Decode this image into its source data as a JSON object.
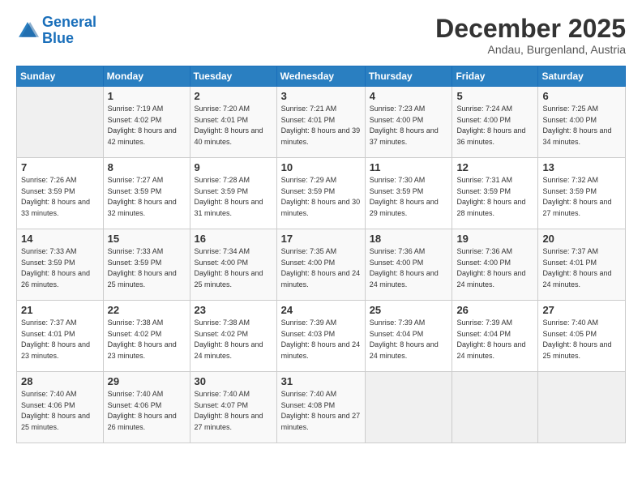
{
  "logo": {
    "line1": "General",
    "line2": "Blue"
  },
  "header": {
    "month": "December 2025",
    "location": "Andau, Burgenland, Austria"
  },
  "days_of_week": [
    "Sunday",
    "Monday",
    "Tuesday",
    "Wednesday",
    "Thursday",
    "Friday",
    "Saturday"
  ],
  "weeks": [
    [
      {
        "day": "",
        "sunrise": "",
        "sunset": "",
        "daylight": ""
      },
      {
        "day": "1",
        "sunrise": "Sunrise: 7:19 AM",
        "sunset": "Sunset: 4:02 PM",
        "daylight": "Daylight: 8 hours and 42 minutes."
      },
      {
        "day": "2",
        "sunrise": "Sunrise: 7:20 AM",
        "sunset": "Sunset: 4:01 PM",
        "daylight": "Daylight: 8 hours and 40 minutes."
      },
      {
        "day": "3",
        "sunrise": "Sunrise: 7:21 AM",
        "sunset": "Sunset: 4:01 PM",
        "daylight": "Daylight: 8 hours and 39 minutes."
      },
      {
        "day": "4",
        "sunrise": "Sunrise: 7:23 AM",
        "sunset": "Sunset: 4:00 PM",
        "daylight": "Daylight: 8 hours and 37 minutes."
      },
      {
        "day": "5",
        "sunrise": "Sunrise: 7:24 AM",
        "sunset": "Sunset: 4:00 PM",
        "daylight": "Daylight: 8 hours and 36 minutes."
      },
      {
        "day": "6",
        "sunrise": "Sunrise: 7:25 AM",
        "sunset": "Sunset: 4:00 PM",
        "daylight": "Daylight: 8 hours and 34 minutes."
      }
    ],
    [
      {
        "day": "7",
        "sunrise": "Sunrise: 7:26 AM",
        "sunset": "Sunset: 3:59 PM",
        "daylight": "Daylight: 8 hours and 33 minutes."
      },
      {
        "day": "8",
        "sunrise": "Sunrise: 7:27 AM",
        "sunset": "Sunset: 3:59 PM",
        "daylight": "Daylight: 8 hours and 32 minutes."
      },
      {
        "day": "9",
        "sunrise": "Sunrise: 7:28 AM",
        "sunset": "Sunset: 3:59 PM",
        "daylight": "Daylight: 8 hours and 31 minutes."
      },
      {
        "day": "10",
        "sunrise": "Sunrise: 7:29 AM",
        "sunset": "Sunset: 3:59 PM",
        "daylight": "Daylight: 8 hours and 30 minutes."
      },
      {
        "day": "11",
        "sunrise": "Sunrise: 7:30 AM",
        "sunset": "Sunset: 3:59 PM",
        "daylight": "Daylight: 8 hours and 29 minutes."
      },
      {
        "day": "12",
        "sunrise": "Sunrise: 7:31 AM",
        "sunset": "Sunset: 3:59 PM",
        "daylight": "Daylight: 8 hours and 28 minutes."
      },
      {
        "day": "13",
        "sunrise": "Sunrise: 7:32 AM",
        "sunset": "Sunset: 3:59 PM",
        "daylight": "Daylight: 8 hours and 27 minutes."
      }
    ],
    [
      {
        "day": "14",
        "sunrise": "Sunrise: 7:33 AM",
        "sunset": "Sunset: 3:59 PM",
        "daylight": "Daylight: 8 hours and 26 minutes."
      },
      {
        "day": "15",
        "sunrise": "Sunrise: 7:33 AM",
        "sunset": "Sunset: 3:59 PM",
        "daylight": "Daylight: 8 hours and 25 minutes."
      },
      {
        "day": "16",
        "sunrise": "Sunrise: 7:34 AM",
        "sunset": "Sunset: 4:00 PM",
        "daylight": "Daylight: 8 hours and 25 minutes."
      },
      {
        "day": "17",
        "sunrise": "Sunrise: 7:35 AM",
        "sunset": "Sunset: 4:00 PM",
        "daylight": "Daylight: 8 hours and 24 minutes."
      },
      {
        "day": "18",
        "sunrise": "Sunrise: 7:36 AM",
        "sunset": "Sunset: 4:00 PM",
        "daylight": "Daylight: 8 hours and 24 minutes."
      },
      {
        "day": "19",
        "sunrise": "Sunrise: 7:36 AM",
        "sunset": "Sunset: 4:00 PM",
        "daylight": "Daylight: 8 hours and 24 minutes."
      },
      {
        "day": "20",
        "sunrise": "Sunrise: 7:37 AM",
        "sunset": "Sunset: 4:01 PM",
        "daylight": "Daylight: 8 hours and 24 minutes."
      }
    ],
    [
      {
        "day": "21",
        "sunrise": "Sunrise: 7:37 AM",
        "sunset": "Sunset: 4:01 PM",
        "daylight": "Daylight: 8 hours and 23 minutes."
      },
      {
        "day": "22",
        "sunrise": "Sunrise: 7:38 AM",
        "sunset": "Sunset: 4:02 PM",
        "daylight": "Daylight: 8 hours and 23 minutes."
      },
      {
        "day": "23",
        "sunrise": "Sunrise: 7:38 AM",
        "sunset": "Sunset: 4:02 PM",
        "daylight": "Daylight: 8 hours and 24 minutes."
      },
      {
        "day": "24",
        "sunrise": "Sunrise: 7:39 AM",
        "sunset": "Sunset: 4:03 PM",
        "daylight": "Daylight: 8 hours and 24 minutes."
      },
      {
        "day": "25",
        "sunrise": "Sunrise: 7:39 AM",
        "sunset": "Sunset: 4:04 PM",
        "daylight": "Daylight: 8 hours and 24 minutes."
      },
      {
        "day": "26",
        "sunrise": "Sunrise: 7:39 AM",
        "sunset": "Sunset: 4:04 PM",
        "daylight": "Daylight: 8 hours and 24 minutes."
      },
      {
        "day": "27",
        "sunrise": "Sunrise: 7:40 AM",
        "sunset": "Sunset: 4:05 PM",
        "daylight": "Daylight: 8 hours and 25 minutes."
      }
    ],
    [
      {
        "day": "28",
        "sunrise": "Sunrise: 7:40 AM",
        "sunset": "Sunset: 4:06 PM",
        "daylight": "Daylight: 8 hours and 25 minutes."
      },
      {
        "day": "29",
        "sunrise": "Sunrise: 7:40 AM",
        "sunset": "Sunset: 4:06 PM",
        "daylight": "Daylight: 8 hours and 26 minutes."
      },
      {
        "day": "30",
        "sunrise": "Sunrise: 7:40 AM",
        "sunset": "Sunset: 4:07 PM",
        "daylight": "Daylight: 8 hours and 27 minutes."
      },
      {
        "day": "31",
        "sunrise": "Sunrise: 7:40 AM",
        "sunset": "Sunset: 4:08 PM",
        "daylight": "Daylight: 8 hours and 27 minutes."
      },
      {
        "day": "",
        "sunrise": "",
        "sunset": "",
        "daylight": ""
      },
      {
        "day": "",
        "sunrise": "",
        "sunset": "",
        "daylight": ""
      },
      {
        "day": "",
        "sunrise": "",
        "sunset": "",
        "daylight": ""
      }
    ]
  ]
}
